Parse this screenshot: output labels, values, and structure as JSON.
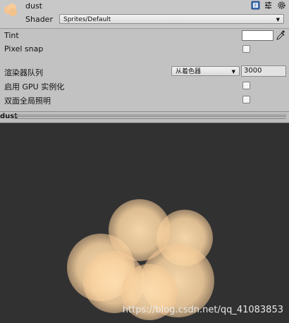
{
  "material": {
    "name": "dust",
    "shader_label": "Shader",
    "shader_value": "Sprites/Default",
    "thumbnail_color": "#f7c99a"
  },
  "header_icons": [
    "book-icon",
    "sliders-icon",
    "gear-icon"
  ],
  "properties": {
    "tint_label": "Tint",
    "tint_color": "#ffffff",
    "pixel_snap_label": "Pixel snap",
    "pixel_snap_checked": false,
    "render_queue_label": "渲染器队列",
    "render_queue_option": "从着色器",
    "render_queue_value": "3000",
    "gpu_instancing_label": "启用 GPU 实例化",
    "gpu_instancing_checked": false,
    "double_sided_gi_label": "双面全局照明",
    "double_sided_gi_checked": false
  },
  "preview": {
    "title": "dust",
    "background": "#313131",
    "sprite_color": "#fdd8a6",
    "watermark": "https://blog.csdn.net/qq_41083853"
  }
}
